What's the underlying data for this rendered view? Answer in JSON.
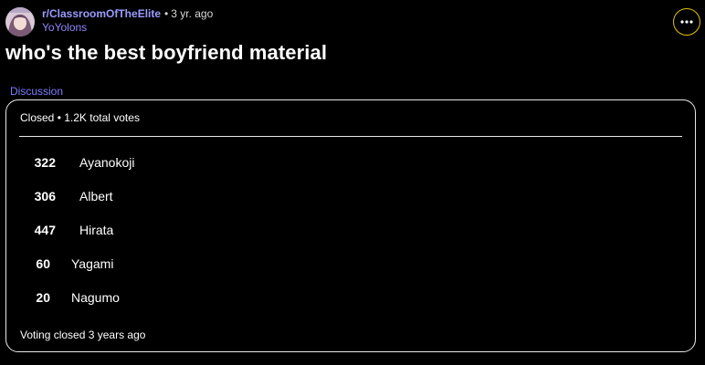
{
  "post": {
    "subreddit": "r/ClassroomOfTheElite",
    "separator": "•",
    "age": "3 yr. ago",
    "username": "YoYolons",
    "title": "who's the best boyfriend material",
    "flair": "Discussion",
    "avatar_icon": "user-avatar",
    "more_icon": "more-options-icon",
    "more_button_color": "#e5c400"
  },
  "poll": {
    "status": "Closed • 1.2K total votes",
    "options": [
      {
        "votes": "322",
        "label": "Ayanokoji"
      },
      {
        "votes": "306",
        "label": "Albert"
      },
      {
        "votes": "447",
        "label": "Hirata"
      },
      {
        "votes": "60",
        "label": "Yagami"
      },
      {
        "votes": "20",
        "label": "Nagumo"
      }
    ],
    "footer": "Voting closed 3 years ago"
  }
}
